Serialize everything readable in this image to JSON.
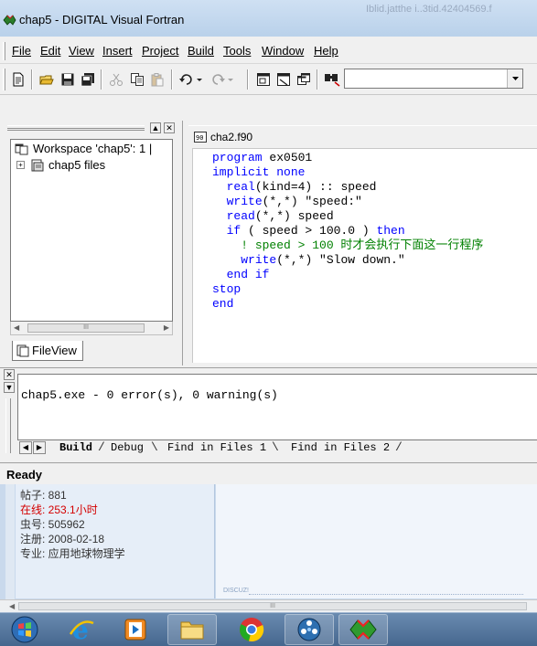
{
  "window": {
    "title": "chap5 - DIGITAL Visual Fortran",
    "background_title": "Iblid.jatthe i..3tid.42404569.f"
  },
  "menu": [
    "File",
    "Edit",
    "View",
    "Insert",
    "Project",
    "Build",
    "Tools",
    "Window",
    "Help"
  ],
  "toolbar": {
    "icons": [
      "new-text-file-icon",
      "open-folder-icon",
      "save-icon",
      "save-all-icon",
      "cut-icon",
      "copy-icon",
      "paste-icon",
      "undo-icon",
      "redo-icon",
      "workspace-toggle-icon",
      "output-toggle-icon",
      "window-list-icon",
      "find-in-files-icon"
    ],
    "find_combo_value": ""
  },
  "workspace": {
    "root_label": "Workspace 'chap5': 1 |",
    "files_label": "chap5 files",
    "expander": "+",
    "tab_label": "FileView",
    "scroll_thumb": "III"
  },
  "editor": {
    "tab_label": "cha2.f90",
    "lines": [
      {
        "indent": "",
        "kw": "program",
        "rest": " ex0501",
        "comment": ""
      },
      {
        "indent": "",
        "kw": "implicit none",
        "rest": "",
        "comment": ""
      },
      {
        "indent": "  ",
        "kw": "real",
        "rest": "(kind=4) :: speed",
        "comment": ""
      },
      {
        "indent": "  ",
        "kw": "write",
        "rest": "(*,*) \"speed:\"",
        "comment": ""
      },
      {
        "indent": "  ",
        "kw": "read",
        "rest": "(*,*) speed",
        "comment": ""
      },
      {
        "indent": "  ",
        "kw": "if",
        "rest": " ( speed > 100.0 ) ",
        "comment": "",
        "kw2": "then"
      },
      {
        "indent": "    ",
        "kw": "",
        "rest": "",
        "comment": "! speed > 100 时才会执行下面这一行程序"
      },
      {
        "indent": "    ",
        "kw": "write",
        "rest": "(*,*) \"Slow down.\"",
        "comment": ""
      },
      {
        "indent": "  ",
        "kw": "end if",
        "rest": "",
        "comment": ""
      },
      {
        "indent": "",
        "kw": "stop",
        "rest": "",
        "comment": ""
      },
      {
        "indent": "",
        "kw": "end",
        "rest": "",
        "comment": ""
      }
    ]
  },
  "output": {
    "text": "chap5.exe - 0 error(s), 0 warning(s)",
    "tabs": [
      "Build",
      "Debug",
      "Find in Files 1",
      "Find in Files 2"
    ],
    "active_tab": "Build"
  },
  "status": {
    "text": "Ready"
  },
  "web_profile": {
    "rows": [
      {
        "text": "帖子: 881",
        "style": "normal"
      },
      {
        "text": "在线: 253.1小时",
        "style": "red"
      },
      {
        "text": "虫号: 505962",
        "style": "normal"
      },
      {
        "text": "注册: 2008-02-18",
        "style": "normal"
      },
      {
        "text": "专业: 应用地球物理学",
        "style": "normal"
      }
    ],
    "content_tag": "DISCUZ!",
    "scroll_thumb": "III"
  },
  "taskbar": {
    "items": [
      "start-orb-icon",
      "internet-explorer-icon",
      "media-player-icon",
      "file-explorer-icon",
      "chrome-icon",
      "media-center-icon",
      "visual-fortran-icon"
    ]
  },
  "colors": {
    "keyword": "#0000ff",
    "comment": "#008000",
    "online_red": "#d40000",
    "taskbar": "#45678e"
  }
}
